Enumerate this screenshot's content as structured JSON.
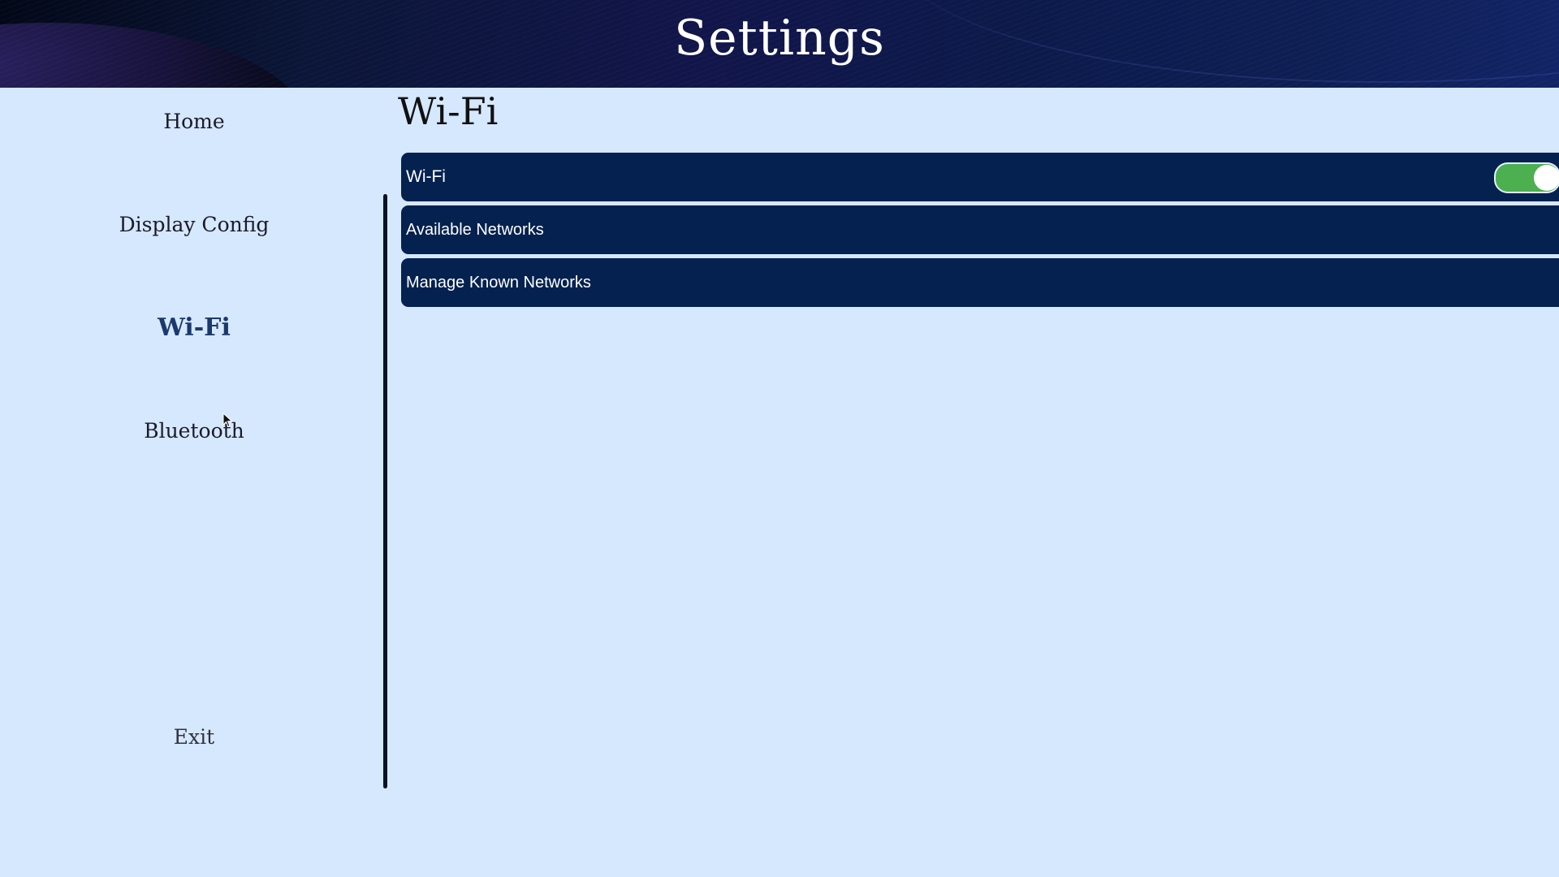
{
  "header": {
    "title": "Settings"
  },
  "sidebar": {
    "items": [
      {
        "label": "Home"
      },
      {
        "label": "Display Config"
      },
      {
        "label": "Wi-Fi",
        "active": true
      },
      {
        "label": "Bluetooth"
      }
    ],
    "exit_label": "Exit"
  },
  "main": {
    "title": "Wi-Fi",
    "rows": [
      {
        "label": "Wi-Fi",
        "toggle_on": true
      },
      {
        "label": "Available Networks"
      },
      {
        "label": "Manage Known Networks"
      }
    ]
  },
  "colors": {
    "background": "#d6e8fd",
    "row": "#04214f",
    "toggle_on": "#4caf50",
    "active_nav": "#1b3a6b"
  },
  "icons": {
    "cursor": "arrow-cursor-icon"
  }
}
